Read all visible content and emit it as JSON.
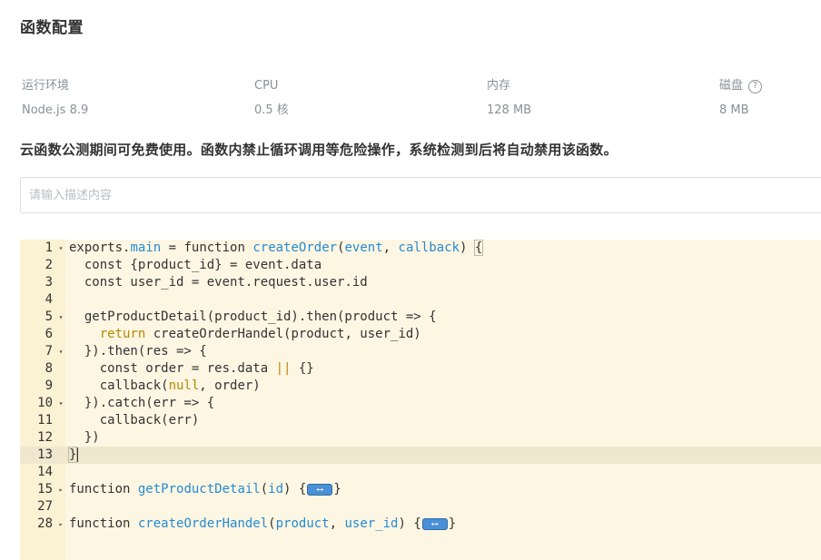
{
  "section": {
    "title": "函数配置"
  },
  "specs": [
    {
      "label": "运行环境",
      "value": "Node.js 8.9"
    },
    {
      "label": "CPU",
      "value": "0.5 核"
    },
    {
      "label": "内存",
      "value": "128 MB"
    },
    {
      "label": "磁盘",
      "value": "8 MB",
      "help_icon": "help-circle-icon"
    }
  ],
  "notice": "云函数公测期间可免费使用。函数内禁止循环调用等危险操作，系统检测到后将自动禁用该函数。",
  "description_input": {
    "placeholder": "请输入描述内容",
    "value": ""
  },
  "editor": {
    "active_line": 13,
    "lines": [
      {
        "num": "1",
        "fold": "open"
      },
      {
        "num": "2"
      },
      {
        "num": "3"
      },
      {
        "num": "4"
      },
      {
        "num": "5",
        "fold": "open"
      },
      {
        "num": "6"
      },
      {
        "num": "7",
        "fold": "open"
      },
      {
        "num": "8"
      },
      {
        "num": "9"
      },
      {
        "num": "10",
        "fold": "open"
      },
      {
        "num": "11"
      },
      {
        "num": "12"
      },
      {
        "num": "13"
      },
      {
        "num": "14"
      },
      {
        "num": "15",
        "fold": "closed"
      },
      {
        "num": "27"
      },
      {
        "num": "28",
        "fold": "closed"
      }
    ],
    "code": {
      "l1_a": "exports",
      "l1_b": ".",
      "l1_c": "main",
      "l1_d": " = ",
      "l1_e": "function",
      "l1_f": " ",
      "l1_g": "createOrder",
      "l1_h": "(",
      "l1_i": "event",
      "l1_j": ", ",
      "l1_k": "callback",
      "l1_l": ") ",
      "l1_m": "{",
      "l2": "  const {product_id} = event.data",
      "l3": "  const user_id = event.request.user.id",
      "l5": "  getProductDetail(product_id).then(product => {",
      "l6_a": "    ",
      "l6_b": "return",
      "l6_c": " createOrderHandel(product, user_id)",
      "l7": "  }).then(res => {",
      "l8_a": "    const order = res.data ",
      "l8_b": "||",
      "l8_c": " {}",
      "l9_a": "    callback(",
      "l9_b": "null",
      "l9_c": ", order)",
      "l10": "  }).catch(err => {",
      "l11": "    callback(err)",
      "l12": "  })",
      "l13": "}",
      "l15_a": "function",
      "l15_b": " ",
      "l15_c": "getProductDetail",
      "l15_d": "(",
      "l15_e": "id",
      "l15_f": ") {",
      "l15_g": "}",
      "l28_a": "function",
      "l28_b": " ",
      "l28_c": "createOrderHandel",
      "l28_d": "(",
      "l28_e": "product",
      "l28_f": ", ",
      "l28_g": "user_id",
      "l28_h": ") {",
      "l28_i": "}"
    },
    "colors": {
      "background": "#fdf6e3",
      "gutter": "#fbf1d3",
      "active_line": "#efe8cf",
      "identifier": "#268bd2",
      "keyword_accent": "#b58900"
    }
  }
}
